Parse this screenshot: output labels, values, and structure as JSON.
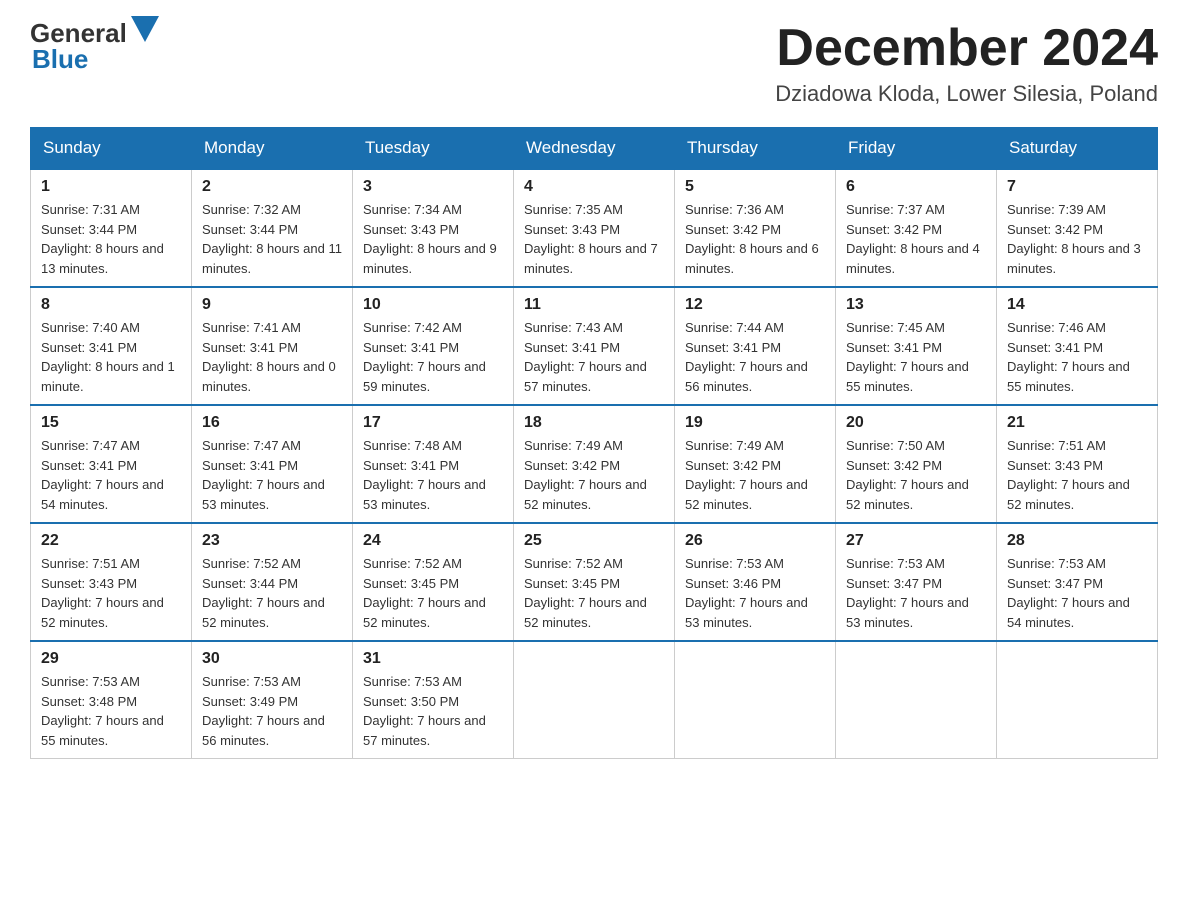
{
  "header": {
    "logo": {
      "general": "General",
      "blue": "Blue"
    },
    "title": "December 2024",
    "location": "Dziadowa Kloda, Lower Silesia, Poland"
  },
  "days_of_week": [
    "Sunday",
    "Monday",
    "Tuesday",
    "Wednesday",
    "Thursday",
    "Friday",
    "Saturday"
  ],
  "weeks": [
    [
      {
        "day": "1",
        "sunrise": "Sunrise: 7:31 AM",
        "sunset": "Sunset: 3:44 PM",
        "daylight": "Daylight: 8 hours and 13 minutes."
      },
      {
        "day": "2",
        "sunrise": "Sunrise: 7:32 AM",
        "sunset": "Sunset: 3:44 PM",
        "daylight": "Daylight: 8 hours and 11 minutes."
      },
      {
        "day": "3",
        "sunrise": "Sunrise: 7:34 AM",
        "sunset": "Sunset: 3:43 PM",
        "daylight": "Daylight: 8 hours and 9 minutes."
      },
      {
        "day": "4",
        "sunrise": "Sunrise: 7:35 AM",
        "sunset": "Sunset: 3:43 PM",
        "daylight": "Daylight: 8 hours and 7 minutes."
      },
      {
        "day": "5",
        "sunrise": "Sunrise: 7:36 AM",
        "sunset": "Sunset: 3:42 PM",
        "daylight": "Daylight: 8 hours and 6 minutes."
      },
      {
        "day": "6",
        "sunrise": "Sunrise: 7:37 AM",
        "sunset": "Sunset: 3:42 PM",
        "daylight": "Daylight: 8 hours and 4 minutes."
      },
      {
        "day": "7",
        "sunrise": "Sunrise: 7:39 AM",
        "sunset": "Sunset: 3:42 PM",
        "daylight": "Daylight: 8 hours and 3 minutes."
      }
    ],
    [
      {
        "day": "8",
        "sunrise": "Sunrise: 7:40 AM",
        "sunset": "Sunset: 3:41 PM",
        "daylight": "Daylight: 8 hours and 1 minute."
      },
      {
        "day": "9",
        "sunrise": "Sunrise: 7:41 AM",
        "sunset": "Sunset: 3:41 PM",
        "daylight": "Daylight: 8 hours and 0 minutes."
      },
      {
        "day": "10",
        "sunrise": "Sunrise: 7:42 AM",
        "sunset": "Sunset: 3:41 PM",
        "daylight": "Daylight: 7 hours and 59 minutes."
      },
      {
        "day": "11",
        "sunrise": "Sunrise: 7:43 AM",
        "sunset": "Sunset: 3:41 PM",
        "daylight": "Daylight: 7 hours and 57 minutes."
      },
      {
        "day": "12",
        "sunrise": "Sunrise: 7:44 AM",
        "sunset": "Sunset: 3:41 PM",
        "daylight": "Daylight: 7 hours and 56 minutes."
      },
      {
        "day": "13",
        "sunrise": "Sunrise: 7:45 AM",
        "sunset": "Sunset: 3:41 PM",
        "daylight": "Daylight: 7 hours and 55 minutes."
      },
      {
        "day": "14",
        "sunrise": "Sunrise: 7:46 AM",
        "sunset": "Sunset: 3:41 PM",
        "daylight": "Daylight: 7 hours and 55 minutes."
      }
    ],
    [
      {
        "day": "15",
        "sunrise": "Sunrise: 7:47 AM",
        "sunset": "Sunset: 3:41 PM",
        "daylight": "Daylight: 7 hours and 54 minutes."
      },
      {
        "day": "16",
        "sunrise": "Sunrise: 7:47 AM",
        "sunset": "Sunset: 3:41 PM",
        "daylight": "Daylight: 7 hours and 53 minutes."
      },
      {
        "day": "17",
        "sunrise": "Sunrise: 7:48 AM",
        "sunset": "Sunset: 3:41 PM",
        "daylight": "Daylight: 7 hours and 53 minutes."
      },
      {
        "day": "18",
        "sunrise": "Sunrise: 7:49 AM",
        "sunset": "Sunset: 3:42 PM",
        "daylight": "Daylight: 7 hours and 52 minutes."
      },
      {
        "day": "19",
        "sunrise": "Sunrise: 7:49 AM",
        "sunset": "Sunset: 3:42 PM",
        "daylight": "Daylight: 7 hours and 52 minutes."
      },
      {
        "day": "20",
        "sunrise": "Sunrise: 7:50 AM",
        "sunset": "Sunset: 3:42 PM",
        "daylight": "Daylight: 7 hours and 52 minutes."
      },
      {
        "day": "21",
        "sunrise": "Sunrise: 7:51 AM",
        "sunset": "Sunset: 3:43 PM",
        "daylight": "Daylight: 7 hours and 52 minutes."
      }
    ],
    [
      {
        "day": "22",
        "sunrise": "Sunrise: 7:51 AM",
        "sunset": "Sunset: 3:43 PM",
        "daylight": "Daylight: 7 hours and 52 minutes."
      },
      {
        "day": "23",
        "sunrise": "Sunrise: 7:52 AM",
        "sunset": "Sunset: 3:44 PM",
        "daylight": "Daylight: 7 hours and 52 minutes."
      },
      {
        "day": "24",
        "sunrise": "Sunrise: 7:52 AM",
        "sunset": "Sunset: 3:45 PM",
        "daylight": "Daylight: 7 hours and 52 minutes."
      },
      {
        "day": "25",
        "sunrise": "Sunrise: 7:52 AM",
        "sunset": "Sunset: 3:45 PM",
        "daylight": "Daylight: 7 hours and 52 minutes."
      },
      {
        "day": "26",
        "sunrise": "Sunrise: 7:53 AM",
        "sunset": "Sunset: 3:46 PM",
        "daylight": "Daylight: 7 hours and 53 minutes."
      },
      {
        "day": "27",
        "sunrise": "Sunrise: 7:53 AM",
        "sunset": "Sunset: 3:47 PM",
        "daylight": "Daylight: 7 hours and 53 minutes."
      },
      {
        "day": "28",
        "sunrise": "Sunrise: 7:53 AM",
        "sunset": "Sunset: 3:47 PM",
        "daylight": "Daylight: 7 hours and 54 minutes."
      }
    ],
    [
      {
        "day": "29",
        "sunrise": "Sunrise: 7:53 AM",
        "sunset": "Sunset: 3:48 PM",
        "daylight": "Daylight: 7 hours and 55 minutes."
      },
      {
        "day": "30",
        "sunrise": "Sunrise: 7:53 AM",
        "sunset": "Sunset: 3:49 PM",
        "daylight": "Daylight: 7 hours and 56 minutes."
      },
      {
        "day": "31",
        "sunrise": "Sunrise: 7:53 AM",
        "sunset": "Sunset: 3:50 PM",
        "daylight": "Daylight: 7 hours and 57 minutes."
      },
      null,
      null,
      null,
      null
    ]
  ]
}
